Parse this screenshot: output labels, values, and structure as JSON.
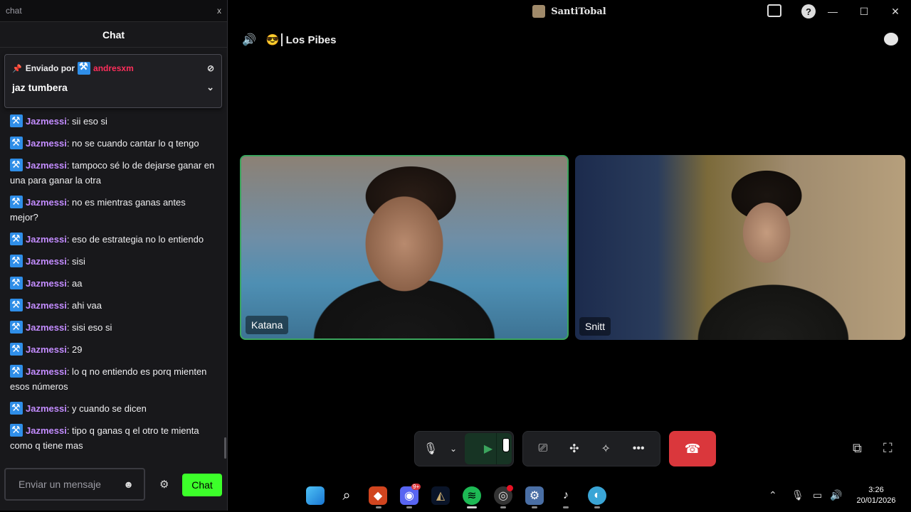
{
  "chat_window": {
    "title": "chat",
    "close_label": "x",
    "header": "Chat",
    "pinned": {
      "prefix": "Enviado por",
      "user": "andresxm",
      "message": "jaz tumbera"
    },
    "messages": [
      {
        "user": "Jazmessi",
        "text": ": sii eso si"
      },
      {
        "user": "Jazmessi",
        "text": ": no se cuando cantar lo q tengo"
      },
      {
        "user": "Jazmessi",
        "text": ": tampoco sé lo de dejarse ganar en una para ganar la otra"
      },
      {
        "user": "Jazmessi",
        "text": ": no es mientras ganas antes mejor?"
      },
      {
        "user": "Jazmessi",
        "text": ": eso de estrategia no lo entiendo"
      },
      {
        "user": "Jazmessi",
        "text": ": sisi"
      },
      {
        "user": "Jazmessi",
        "text": ": aa"
      },
      {
        "user": "Jazmessi",
        "text": ": ahi vaa"
      },
      {
        "user": "Jazmessi",
        "text": ": sisi eso si"
      },
      {
        "user": "Jazmessi",
        "text": ": 29"
      },
      {
        "user": "Jazmessi",
        "text": ": lo q no entiendo es porq mienten esos números"
      },
      {
        "user": "Jazmessi",
        "text": ": y cuando se dicen"
      },
      {
        "user": "Jazmessi",
        "text": ": tipo q ganas q el otro te mienta como q tiene mas"
      }
    ],
    "input_placeholder": "Enviar un mensaje",
    "send_label": "Chat"
  },
  "call_window": {
    "app_title": "SantiTobal",
    "channel_name": "Los Pibes",
    "participants": [
      {
        "name": "Katana",
        "speaking": true
      },
      {
        "name": "Snitt",
        "speaking": false
      }
    ]
  },
  "taskbar": {
    "discord_badge": "9+",
    "time": "3:26",
    "date": "20/01/2026"
  },
  "colors": {
    "accent_green": "#3ba55d",
    "hangup_red": "#da373c",
    "chat_username": "#c38cff",
    "pinned_username": "#ff2e5b",
    "chat_send_button": "#3cff2a"
  }
}
